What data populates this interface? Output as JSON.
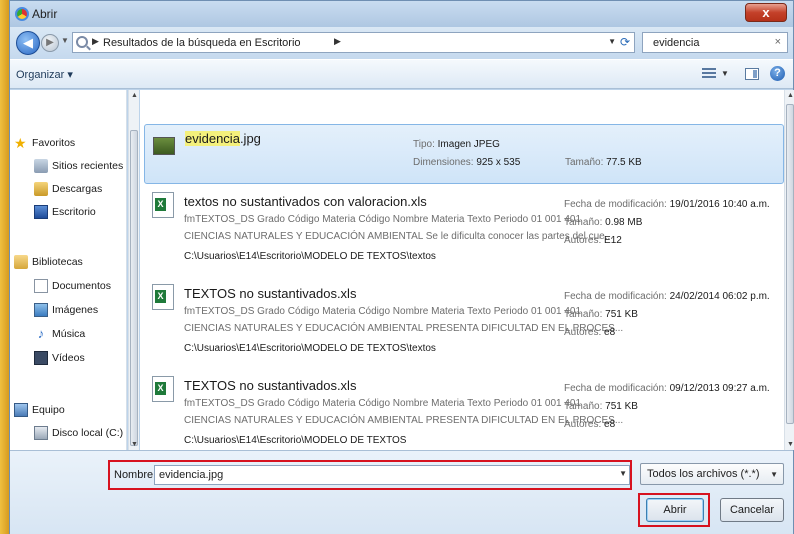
{
  "window": {
    "title": "Abrir",
    "close_label": "x"
  },
  "address": {
    "path_text": "Resultados de la búsqueda en Escritorio",
    "search_value": "evidencia"
  },
  "toolbar": {
    "organize_label": "Organizar ▾"
  },
  "nav": {
    "items": [
      {
        "label": "Favoritos",
        "icon": "star-icon"
      },
      {
        "label": "Sitios recientes",
        "icon": "recent-places-icon"
      },
      {
        "label": "Descargas",
        "icon": "downloads-icon"
      },
      {
        "label": "Escritorio",
        "icon": "desktop-icon"
      },
      {
        "label": "Bibliotecas",
        "icon": "libraries-icon"
      },
      {
        "label": "Documentos",
        "icon": "documents-icon"
      },
      {
        "label": "Imágenes",
        "icon": "pictures-icon"
      },
      {
        "label": "Música",
        "icon": "music-icon"
      },
      {
        "label": "Vídeos",
        "icon": "videos-icon"
      },
      {
        "label": "Equipo",
        "icon": "computer-icon"
      },
      {
        "label": "Disco local (C:)",
        "icon": "local-disk-icon"
      }
    ]
  },
  "results": [
    {
      "name_highlight": "evidencia",
      "name_rest": ".jpg",
      "type_label": "Tipo:",
      "type_value": "Imagen JPEG",
      "dims_label": "Dimensiones:",
      "dims_value": "925 x 535",
      "size_label": "Tamaño:",
      "size_value": "77.5 KB"
    },
    {
      "name": "textos no sustantivados con valoracion.xls",
      "snippet1": "fmTEXTOS_DS Grado Código Materia Código Nombre Materia Texto Periodo 01 001 401",
      "snippet2": "CIENCIAS NATURALES Y EDUCACIÓN AMBIENTAL Se le dificulta conocer las partes del cue...",
      "path": "C:\\Usuarios\\E14\\Escritorio\\MODELO DE TEXTOS\\textos",
      "date_label": "Fecha de modificación:",
      "date_value": "19/01/2016 10:40 a.m.",
      "size_label": "Tamaño:",
      "size_value": "0.98 MB",
      "author_label": "Autores:",
      "author_value": "E12"
    },
    {
      "name": "TEXTOS no sustantivados.xls",
      "snippet1": "fmTEXTOS_DS Grado Código Materia Código Nombre Materia Texto Periodo 01 001 401",
      "snippet2": "CIENCIAS NATURALES Y EDUCACIÓN AMBIENTAL PRESENTA DIFICULTAD EN EL PROCES...",
      "path": "C:\\Usuarios\\E14\\Escritorio\\MODELO DE TEXTOS\\textos",
      "date_label": "Fecha de modificación:",
      "date_value": "24/02/2014 06:02 p.m.",
      "size_label": "Tamaño:",
      "size_value": "751 KB",
      "author_label": "Autores:",
      "author_value": "e8"
    },
    {
      "name": "TEXTOS no sustantivados.xls",
      "snippet1": "fmTEXTOS_DS Grado Código Materia Código Nombre Materia Texto Periodo 01 001 401",
      "snippet2": "CIENCIAS NATURALES Y EDUCACIÓN AMBIENTAL PRESENTA DIFICULTAD EN EL PROCES...",
      "path": "C:\\Usuarios\\E14\\Escritorio\\MODELO DE TEXTOS",
      "date_label": "Fecha de modificación:",
      "date_value": "09/12/2013 09:27 a.m.",
      "size_label": "Tamaño:",
      "size_value": "751 KB",
      "author_label": "Autores:",
      "author_value": "e8"
    }
  ],
  "bottom": {
    "name_label": "Nombre:",
    "name_value": "evidencia.jpg",
    "filter_value": "Todos los archivos (*.*)",
    "open_label": "Abrir",
    "cancel_label": "Cancelar"
  }
}
